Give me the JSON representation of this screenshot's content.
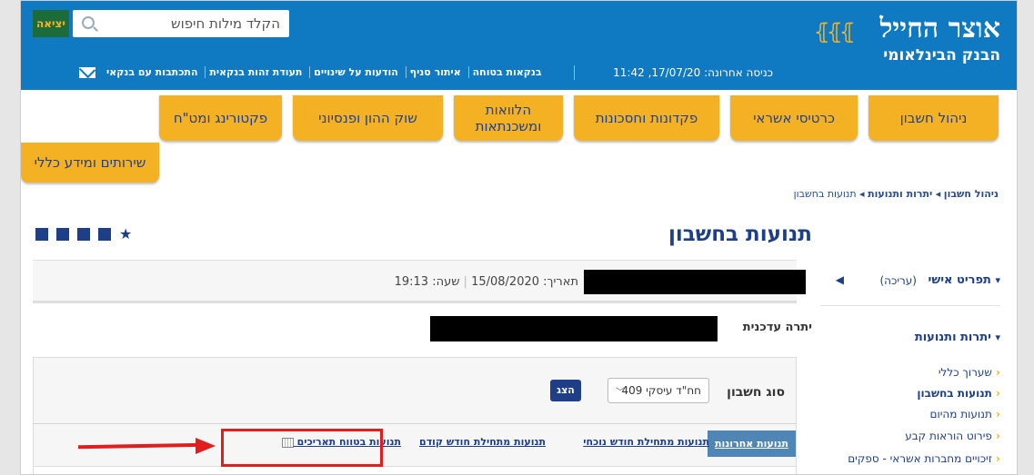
{
  "header": {
    "logo_main": "אוצר החייל",
    "logo_sub": "הבנק הבינלאומי",
    "search_placeholder": "הקלד מילות חיפוש",
    "exit_label": "יציאה",
    "last_login": "כניסה אחרונה: 17/07/20, 11:42",
    "top_links": [
      "בנקאות בטוחה",
      "איתור סניף",
      "הודעות על שינויים",
      "תעודת זהות בנקאית",
      "התכתבות עם בנקאי"
    ]
  },
  "nav": {
    "tabs": [
      "ניהול חשבון",
      "כרטיסי אשראי",
      "פקדונות וחסכונות",
      "הלוואות ומשכנתאות",
      "שוק ההון ופנסיוני",
      "פקטורינג ומט\"ח",
      "שירותים ומידע כללי"
    ]
  },
  "breadcrumb": {
    "items": [
      "ניהול חשבון",
      "יתרות ותנועות",
      "תנועות בחשבון"
    ]
  },
  "page": {
    "title": "תנועות בחשבון",
    "date_label": "תאריך: 15/08/2020",
    "time_label": "שעה: 19:13",
    "balance_label": "יתרה עדכנית"
  },
  "sidebar": {
    "personal": "תפריט אישי",
    "edit": "(עריכה)",
    "section": "יתרות ותנועות",
    "items": [
      "שערוך כללי",
      "תנועות בחשבון",
      "תנועות מהיום",
      "פירוט הוראות קבע",
      "זיכויים מחברות אשראי - ספקים"
    ]
  },
  "panel": {
    "account_type_label": "סוג חשבון",
    "account_selected": "חח\"ד עיסקי 409",
    "show_button": "הצג",
    "tabs": [
      "תנועות אחרונות",
      "תנועות מתחילת חודש נוכחי",
      "תנועות מתחילת חודש קודם",
      "תנועות בטווח תאריכים"
    ]
  }
}
